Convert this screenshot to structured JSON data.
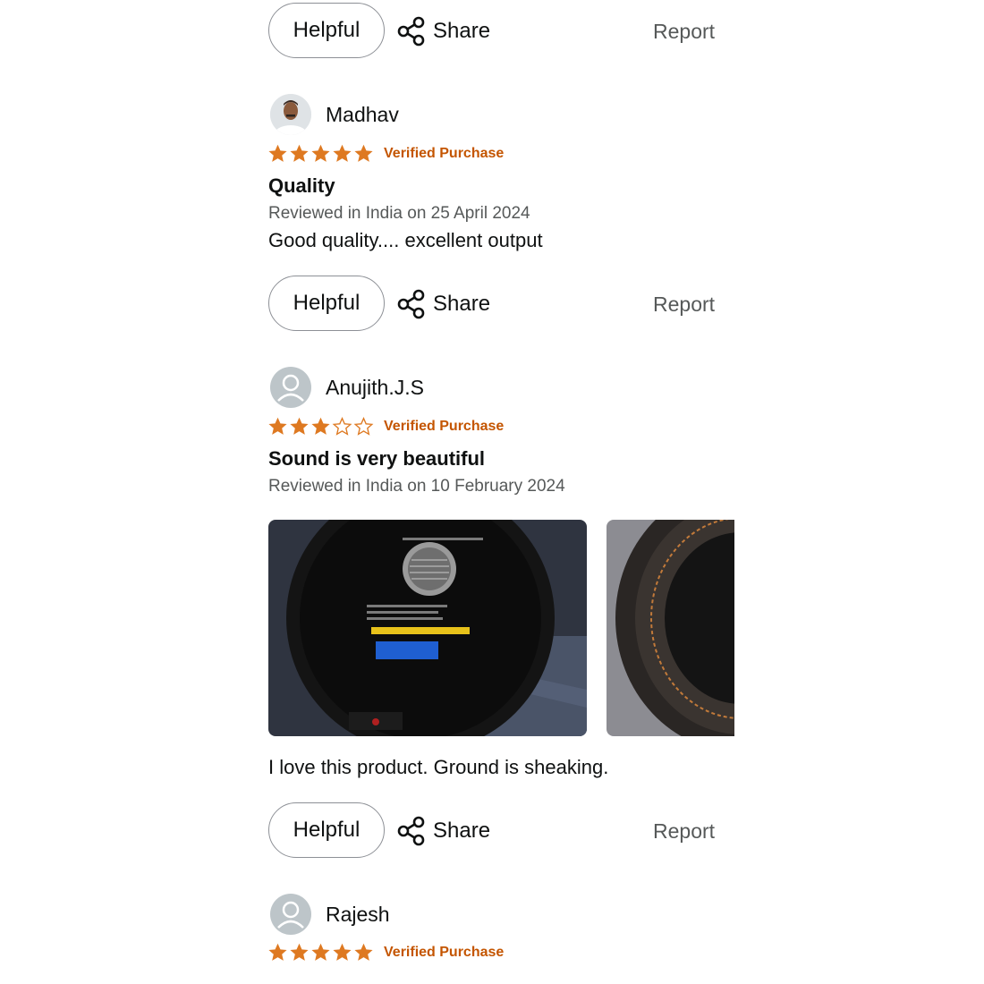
{
  "actions": {
    "helpful_label": "Helpful",
    "share_label": "Share",
    "report_label": "Report"
  },
  "reviews": [
    {
      "reviewer": "Madhav",
      "rating": 5,
      "verified_label": "Verified Purchase",
      "title": "Quality",
      "date_text": "Reviewed in India on 25 April 2024",
      "body": "Good quality.... excellent output"
    },
    {
      "reviewer": "Anujith.J.S",
      "rating": 3,
      "verified_label": "Verified Purchase",
      "title": "Sound is very beautiful",
      "date_text": "Reviewed in India on 10 February 2024",
      "body": "I love this product. Ground is sheaking."
    },
    {
      "reviewer": "Rajesh",
      "rating": 5,
      "verified_label": "Verified Purchase"
    }
  ],
  "colors": {
    "star": "#de7921",
    "verified": "#c45500",
    "muted_text": "#565959",
    "button_border": "#8d9096"
  }
}
